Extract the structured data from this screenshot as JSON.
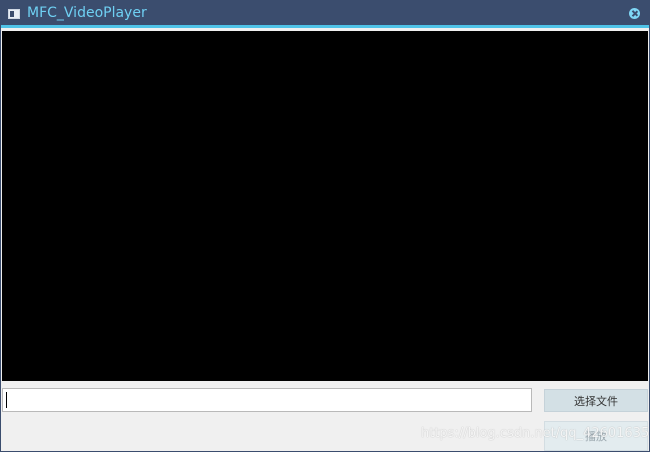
{
  "window": {
    "title": "MFC_VideoPlayer",
    "colors": {
      "titlebar": "#3b4d6e",
      "title_text": "#6fd0f3",
      "accent_line": "#4fc3e8",
      "video_background": "#000000",
      "button_face": "#d3e0e5"
    }
  },
  "input": {
    "value": "",
    "placeholder": ""
  },
  "buttons": {
    "select_file": "选择文件",
    "play": "播放"
  },
  "watermark": {
    "text": "https://blog.csdn.net/qq_42601635"
  },
  "icons": {
    "app": "app-window-icon",
    "close": "close-icon"
  }
}
